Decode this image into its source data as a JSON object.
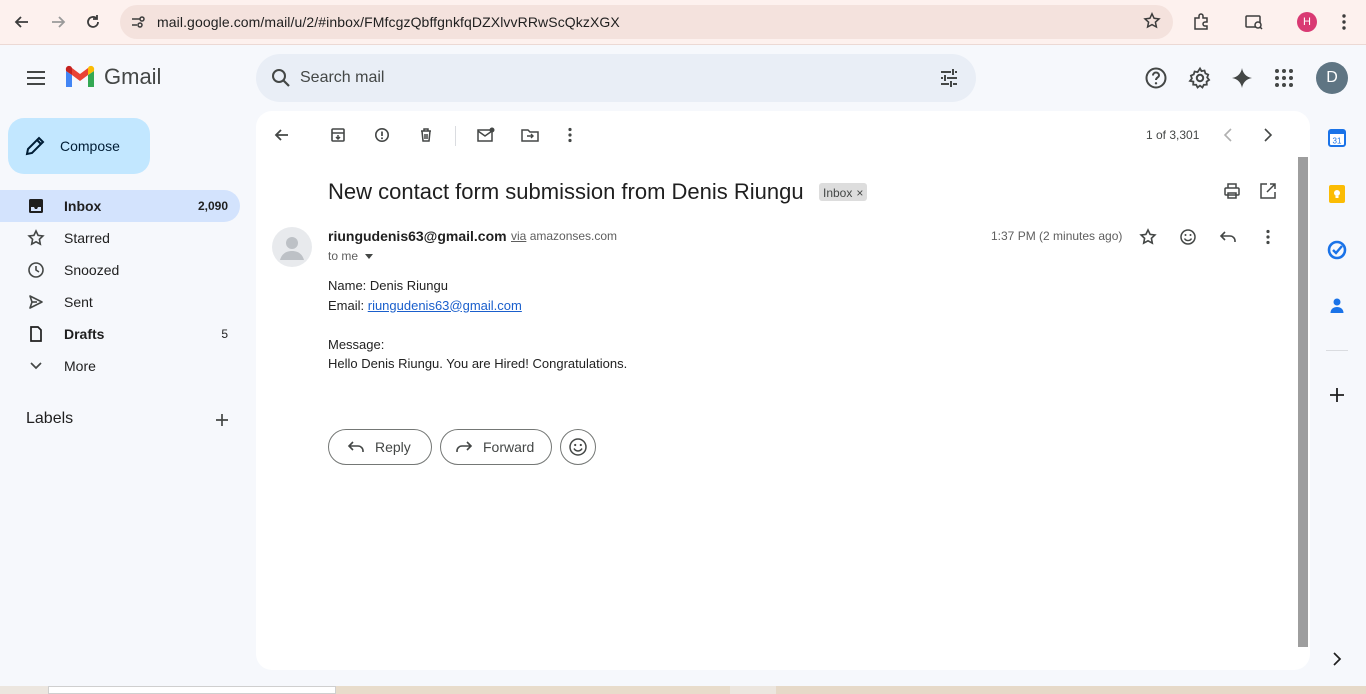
{
  "browser": {
    "url": "mail.google.com/mail/u/2/#inbox/FMfcgzQbffgnkfqDZXlvvRRwScQkzXGX",
    "profile_initial": "H"
  },
  "header": {
    "app_name": "Gmail",
    "search_placeholder": "Search mail",
    "avatar_initial": "D"
  },
  "sidebar": {
    "compose_label": "Compose",
    "items": [
      {
        "label": "Inbox",
        "count": "2,090"
      },
      {
        "label": "Starred",
        "count": ""
      },
      {
        "label": "Snoozed",
        "count": ""
      },
      {
        "label": "Sent",
        "count": ""
      },
      {
        "label": "Drafts",
        "count": "5"
      },
      {
        "label": "More",
        "count": ""
      }
    ],
    "labels_title": "Labels"
  },
  "email": {
    "pager": "1 of 3,301",
    "subject": "New contact form submission from Denis Riungu",
    "label_chip": "Inbox",
    "sender": "riungudenis63@gmail.com",
    "via_label": "via",
    "via_domain": "amazonses.com",
    "to": "to me",
    "time": "1:37 PM (2 minutes ago)",
    "body": {
      "name_line": "Name: Denis Riungu",
      "email_prefix": "Email: ",
      "email_link": "riungudenis63@gmail.com",
      "message_label": "Message:",
      "message_text": "Hello Denis Riungu. You are Hired! Congratulations."
    },
    "reply_label": "Reply",
    "forward_label": "Forward"
  },
  "colors": {
    "compose_bg": "#c2e7ff",
    "active_nav_bg": "#d3e3fd",
    "search_bg": "#e9eef6",
    "link": "#1a5fcc"
  }
}
